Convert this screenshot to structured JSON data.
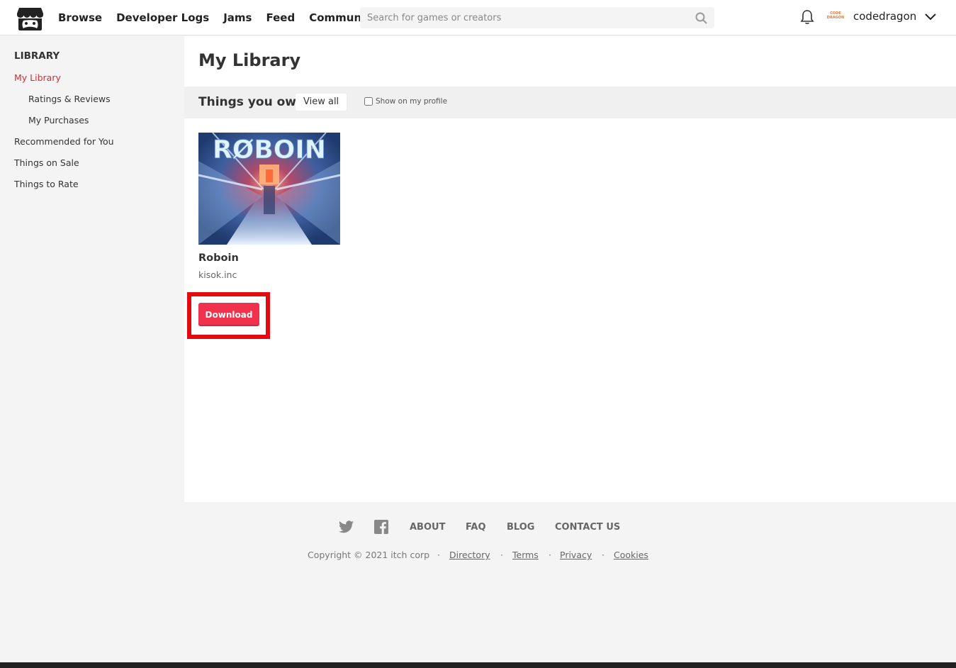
{
  "header": {
    "nav": [
      "Browse",
      "Developer Logs",
      "Jams",
      "Feed",
      "Community"
    ],
    "search_placeholder": "Search for games or creators",
    "avatar_text": "CODE DRAGON",
    "username": "codedragon"
  },
  "sidebar": {
    "title": "LIBRARY",
    "items": [
      {
        "label": "My Library"
      },
      {
        "label": "Ratings & Reviews"
      },
      {
        "label": "My Purchases"
      },
      {
        "label": "Recommended for You"
      },
      {
        "label": "Things on Sale"
      },
      {
        "label": "Things to Rate"
      }
    ]
  },
  "main": {
    "title": "My Library",
    "section_title": "Things you own",
    "view_all": "View all",
    "show_on_profile": "Show on my profile",
    "game": {
      "cover_text": "RØBOIN",
      "title": "Roboin",
      "author": "kisok.inc",
      "download_label": "Download"
    }
  },
  "footer": {
    "links": [
      "ABOUT",
      "FAQ",
      "BLOG",
      "CONTACT US"
    ],
    "copyright": "Copyright © 2021 itch corp",
    "legal": [
      "Directory",
      "Terms",
      "Privacy",
      "Cookies"
    ],
    "separator": "·"
  },
  "colors": {
    "accent": "#d12c34",
    "download_button": "#f0324d",
    "highlight_box": "#e40b10"
  }
}
